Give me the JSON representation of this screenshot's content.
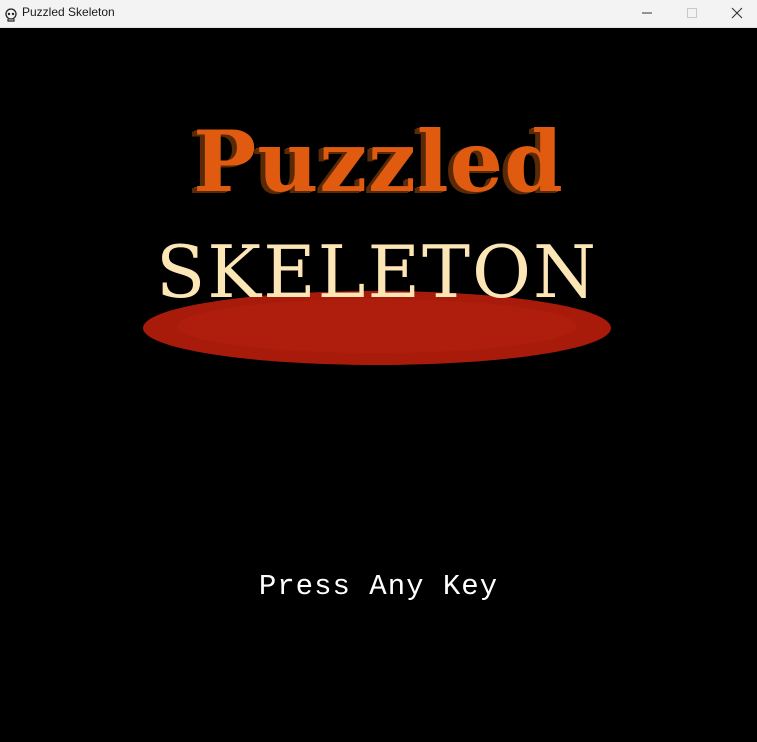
{
  "window": {
    "title": "Puzzled Skeleton",
    "icon": "skull-icon",
    "controls": [
      "minimize-icon",
      "maximize-icon",
      "close-icon"
    ]
  },
  "game": {
    "logo_line1": "Puzzled",
    "logo_line2": "SKELETON",
    "prompt": "Press Any Key",
    "colors": {
      "background": "#000000",
      "puzzled": "#e05a10",
      "skeleton": "#fde6b6",
      "blood": "#a81a0a",
      "prompt": "#ffffff"
    }
  }
}
